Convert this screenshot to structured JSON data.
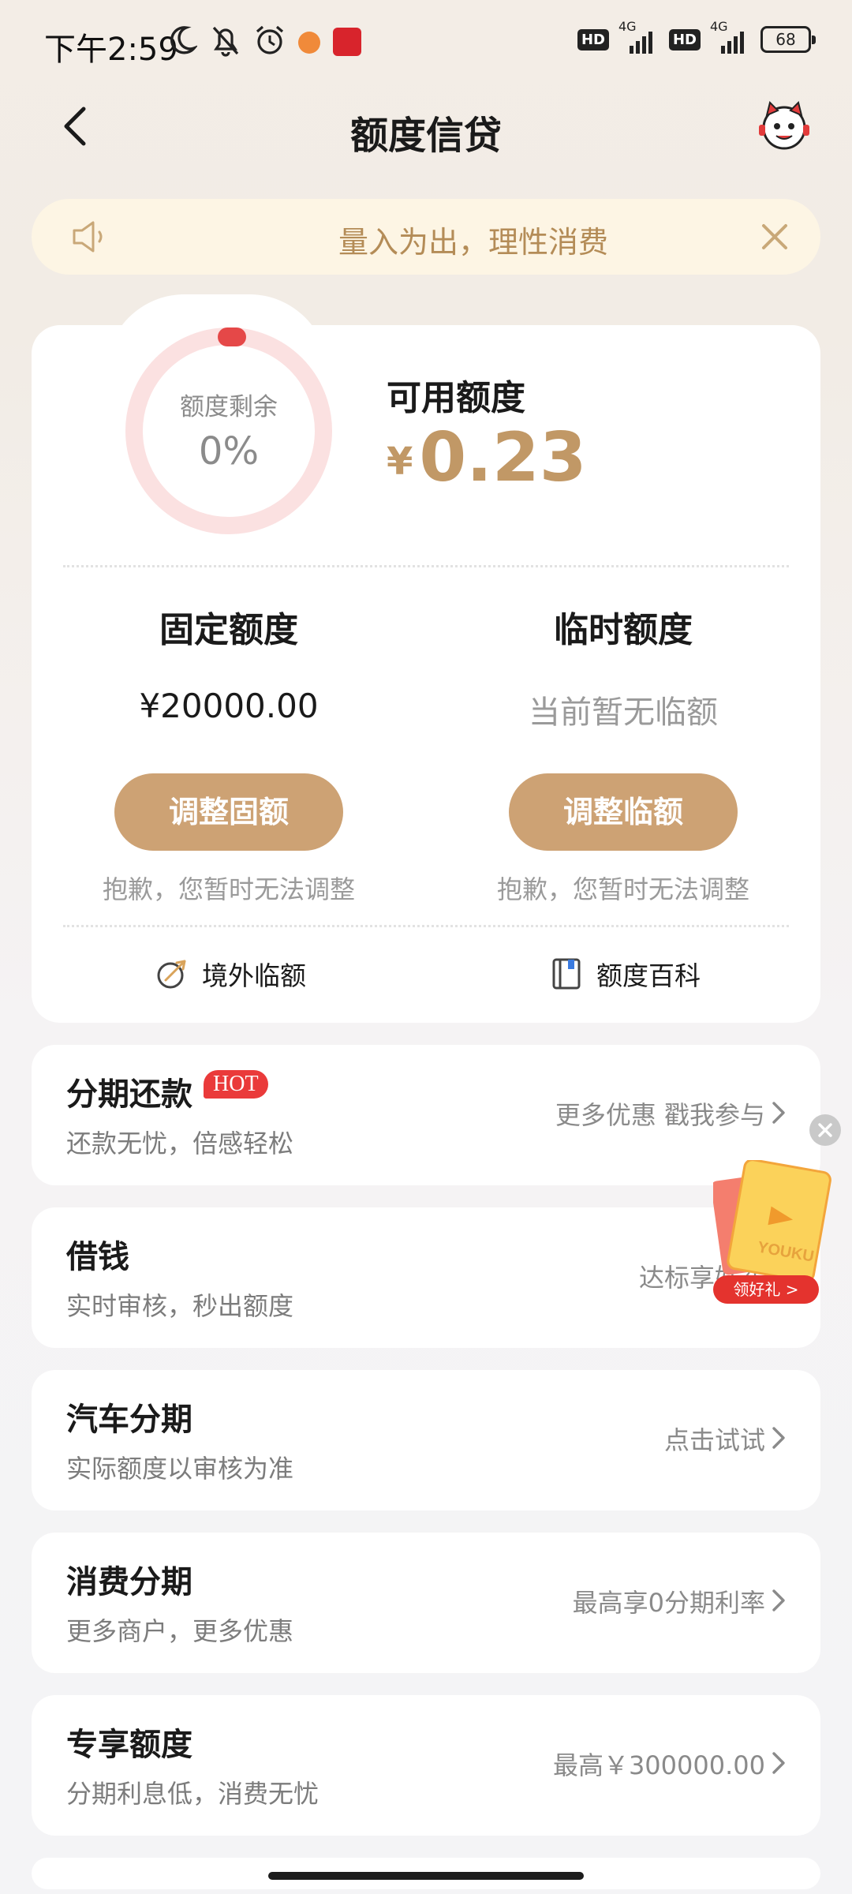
{
  "status_bar": {
    "time": "下午2:59",
    "icons": [
      "moon-icon",
      "mute-bell-icon",
      "alarm-icon"
    ],
    "network_1": "4G",
    "network_2": "4G",
    "hd_1": "HD",
    "hd_2": "HD",
    "battery": "68"
  },
  "nav": {
    "title": "额度信贷"
  },
  "notice": {
    "text": "量入为出，理性消费"
  },
  "credit": {
    "ring_label": "额度剩余",
    "ring_value": "0%",
    "remaining_fraction": 0.0,
    "available_label": "可用额度",
    "available_currency": "¥",
    "available_amount": "0.23",
    "fixed": {
      "title": "固定额度",
      "value": "¥20000.00",
      "button": "调整固额",
      "note": "抱歉，您暂时无法调整"
    },
    "temp": {
      "title": "临时额度",
      "value": "当前暂无临额",
      "button": "调整临额",
      "note": "抱歉，您暂时无法调整"
    },
    "links": {
      "overseas": "境外临额",
      "encyclopedia": "额度百科"
    }
  },
  "items": [
    {
      "title": "分期还款",
      "badge": "HOT",
      "sub": "还款无忧，倍感轻松",
      "right": "更多优惠 戳我参与"
    },
    {
      "title": "借钱",
      "sub": "实时审核，秒出额度",
      "right": "达标享好礼"
    },
    {
      "title": "汽车分期",
      "sub": "实际额度以审核为准",
      "right": "点击试试"
    },
    {
      "title": "消费分期",
      "sub": "更多商户，更多优惠",
      "right": "最高享0分期利率"
    },
    {
      "title": "专享额度",
      "sub": "分期利息低，消费无忧",
      "right": "最高￥300000.00"
    }
  ],
  "promo": {
    "brand": "YOUKU",
    "button": "领好礼 >"
  },
  "colors": {
    "accent": "#cda274",
    "amount": "#c19866",
    "hot": "#ea3a3a",
    "notice_text": "#b48c57",
    "ring": "#fbe1e1",
    "ring_dot": "#e54848"
  }
}
